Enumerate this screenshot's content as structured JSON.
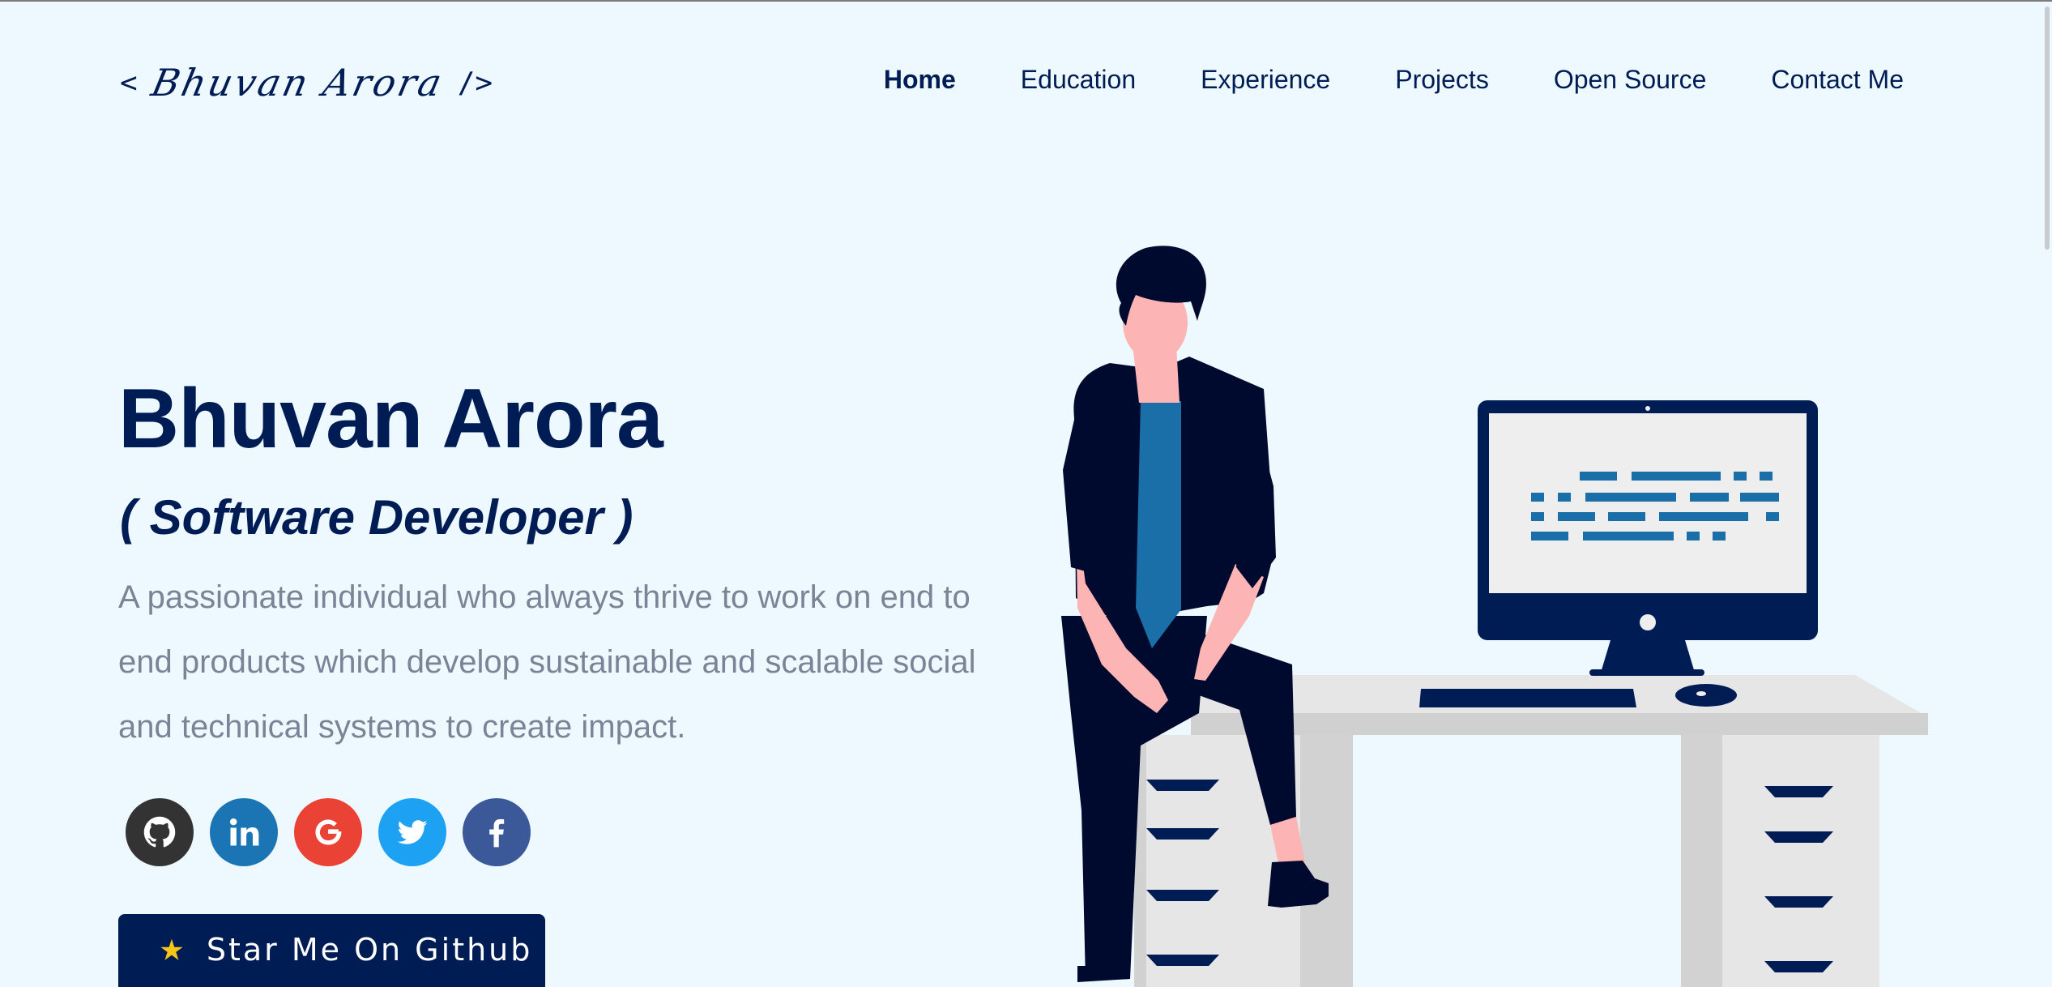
{
  "header": {
    "logo_open": "<",
    "logo_name": "Bhuvan Arora",
    "logo_close": "/>",
    "nav": [
      {
        "label": "Home",
        "active": true
      },
      {
        "label": "Education",
        "active": false
      },
      {
        "label": "Experience",
        "active": false
      },
      {
        "label": "Projects",
        "active": false
      },
      {
        "label": "Open Source",
        "active": false
      },
      {
        "label": "Contact Me",
        "active": false
      }
    ]
  },
  "hero": {
    "title": "Bhuvan Arora",
    "subtitle": "( Software Developer )",
    "description": "A passionate individual who always thrive to work on end to end products which develop sustainable and scalable social and technical systems to create impact."
  },
  "social": [
    {
      "name": "github",
      "icon": "github-icon",
      "color": "#333333"
    },
    {
      "name": "linkedin",
      "icon": "linkedin-icon",
      "color": "#1b75b4"
    },
    {
      "name": "google",
      "icon": "google-icon",
      "color": "#ea4335"
    },
    {
      "name": "twitter",
      "icon": "twitter-icon",
      "color": "#1da1f2"
    },
    {
      "name": "facebook",
      "icon": "facebook-icon",
      "color": "#3b5998"
    }
  ],
  "cta": {
    "label": "Star Me On Github",
    "icon": "star-icon"
  },
  "colors": {
    "background": "#edf9fe",
    "primary": "#001c55",
    "muted_text": "#7b8497",
    "accent_blue": "#1b6fa8"
  }
}
